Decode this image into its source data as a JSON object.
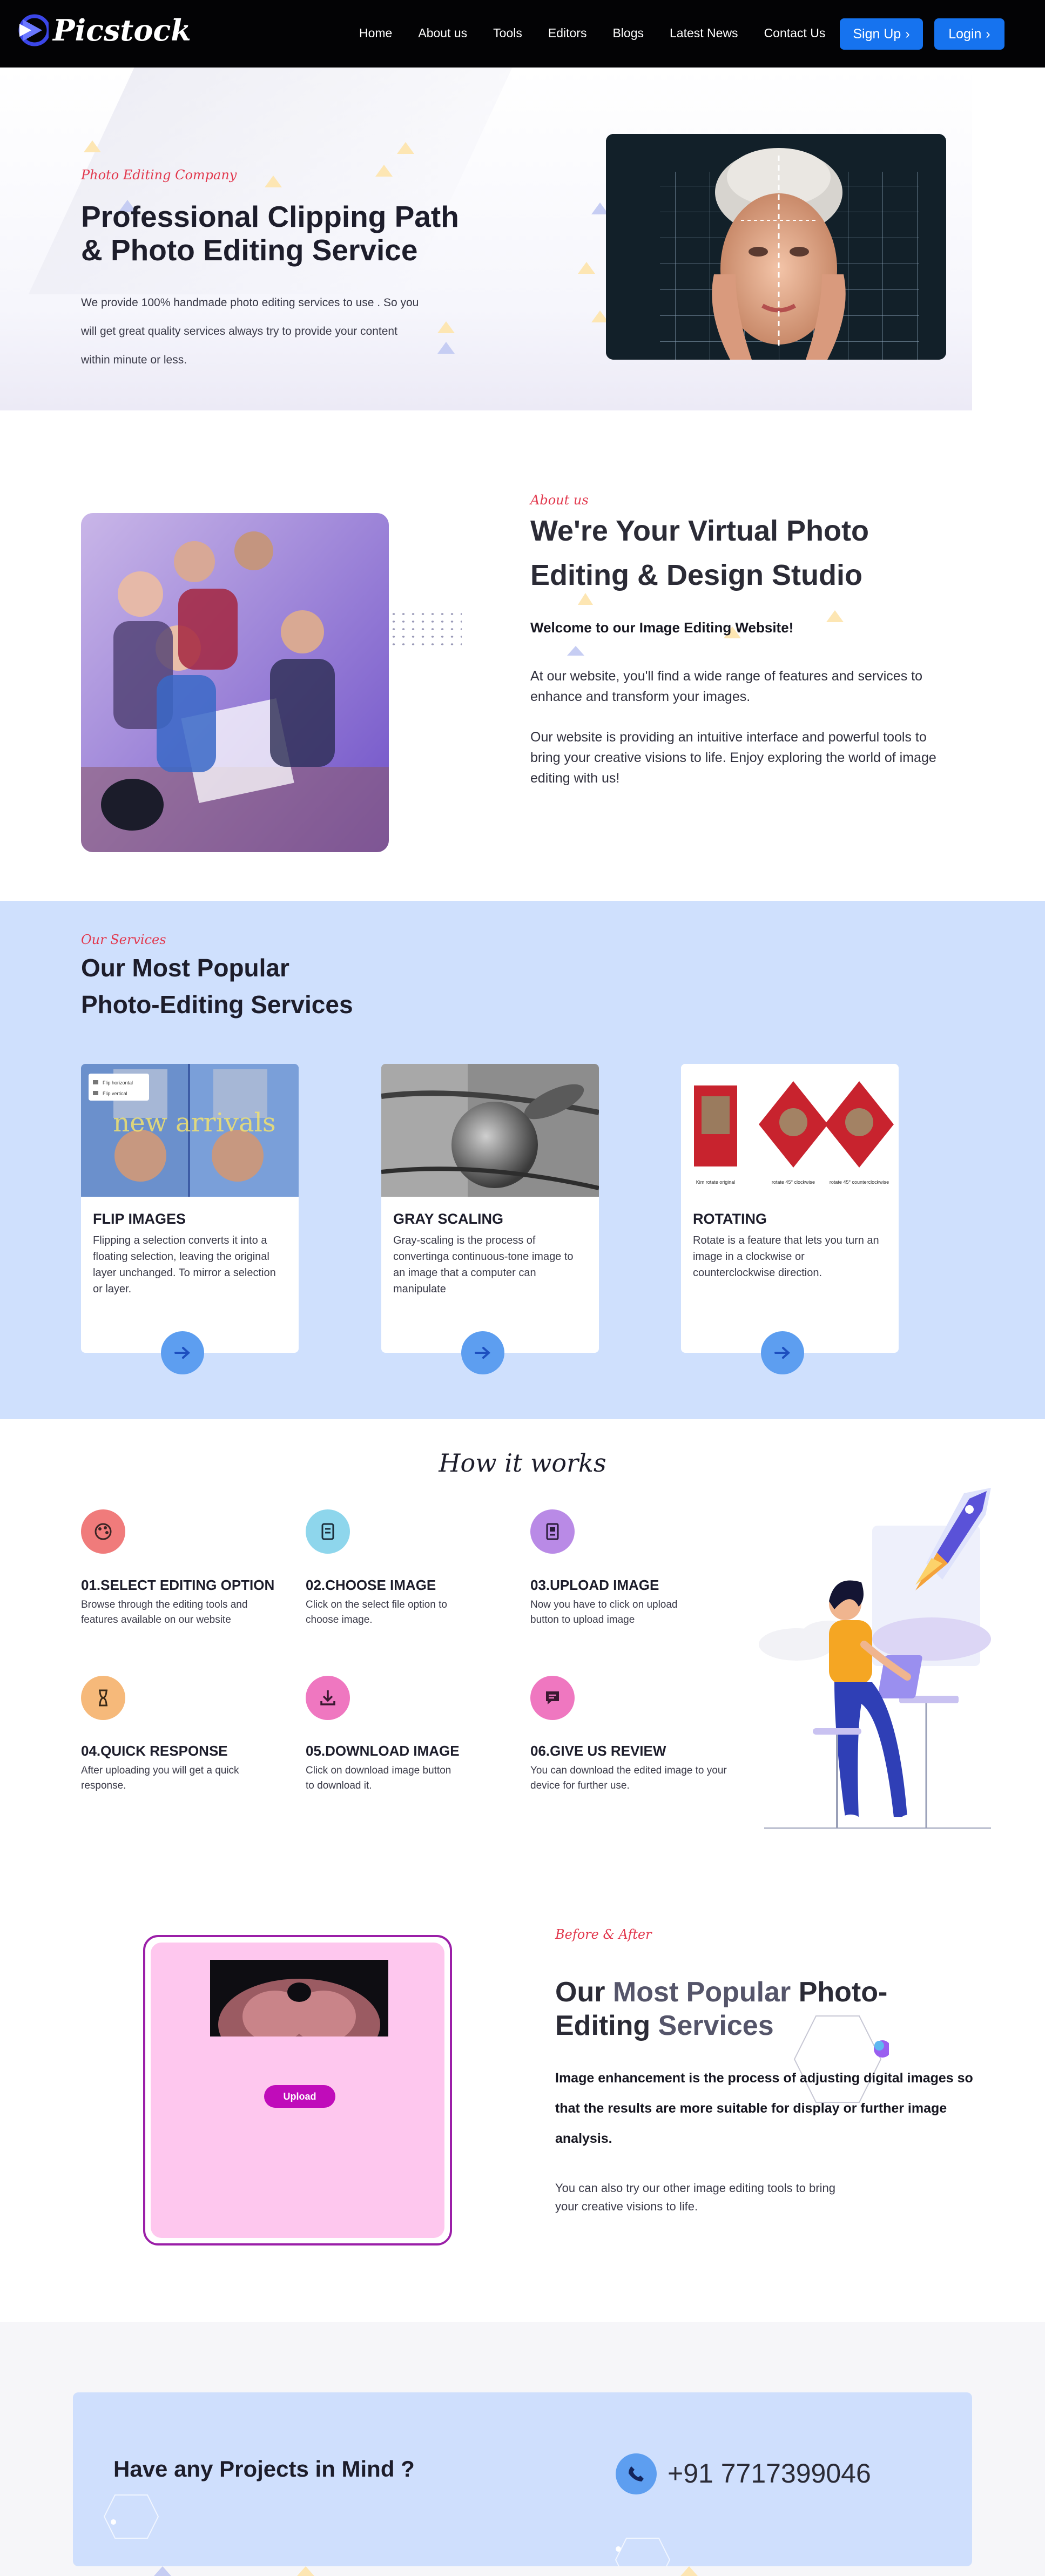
{
  "nav": {
    "brand": "Picstock",
    "links": [
      "Home",
      "About us",
      "Tools",
      "Editors",
      "Blogs",
      "Latest News",
      "Contact Us"
    ],
    "signup_label": "Sign Up",
    "login_label": "Login",
    "accent": "#1673ef"
  },
  "hero": {
    "kicker": "Photo Editing Company",
    "title": "Professional Clipping Path & Photo Editing Service",
    "description": "We provide 100% handmade photo editing services to use . So you will get great quality services always try to provide your content within minute or less."
  },
  "about": {
    "kicker": "About us",
    "title": "We're Your Virtual Photo Editing & Design Studio",
    "welcome": "Welcome to our Image Editing Website!",
    "paragraph_1": "At our website, you'll find a wide range of features and services to enhance and transform your images.",
    "paragraph_2": "Our website is providing an intuitive interface and powerful tools to bring your creative visions to life. Enjoy exploring the world of image editing with us!"
  },
  "services": {
    "kicker": "Our Services",
    "title_line_1": "Our Most Popular",
    "title_line_2": "Photo-Editing Services",
    "cards": [
      {
        "title": "FLIP IMAGES",
        "description": "Flipping a selection converts it into a floating selection, leaving the original layer unchanged. To mirror a selection or layer.",
        "image_text": "new arrivals",
        "menu_item_1": "Flip horizontal",
        "menu_item_2": "Flip vertical"
      },
      {
        "title": "GRAY SCALING",
        "description": "Gray-scaling is the process of convertinga continuous-tone image to an image that a computer can manipulate"
      },
      {
        "title": "ROTATING",
        "description": "Rotate is a feature that lets you turn an image in a clockwise or counterclockwise direction.",
        "captions": [
          "Kim rotate original",
          "rotate 45° clockwise",
          "rotate 45° counterclockwise"
        ]
      }
    ]
  },
  "how": {
    "title": "How it works",
    "steps": [
      {
        "title": "01.SELECT EDITING OPTION",
        "description": "Browse through the editing tools and features available on our website",
        "icon": "palette-icon",
        "color": "#f07b7b"
      },
      {
        "title": "02.CHOOSE IMAGE",
        "description": "Click on the select file option to choose image.",
        "icon": "file-icon",
        "color": "#8ed6ec"
      },
      {
        "title": "03.UPLOAD IMAGE",
        "description": "Now you have to click on upload button to upload image",
        "icon": "document-icon",
        "color": "#b98ae6"
      },
      {
        "title": "04.QUICK RESPONSE",
        "description": "After uploading you will get a quick response.",
        "icon": "hourglass-icon",
        "color": "#f6b97a"
      },
      {
        "title": "05.DOWNLOAD IMAGE",
        "description": "Click on download image button to download it.",
        "icon": "download-icon",
        "color": "#ef77c0"
      },
      {
        "title": "06.GIVE US REVIEW",
        "description": "You can download the edited image to your device for further use.",
        "icon": "chat-icon",
        "color": "#ef77c0"
      }
    ]
  },
  "before_after": {
    "kicker": "Before & After",
    "title_prefix_1": "Our ",
    "title_highlight_1": "Most Popular",
    "title_mid": " Photo-",
    "title_prefix_2": "Editing ",
    "title_highlight_2": "Services",
    "bold_text": "Image enhancement is the process of adjusting digital images so that the results are more suitable for display or further image analysis.",
    "paragraph": "You can also try our other image editing tools to bring your creative visions to life.",
    "upload_label": "Upload"
  },
  "contact": {
    "question": "Have any Projects in Mind ?",
    "phone": "+91 7717399046"
  }
}
